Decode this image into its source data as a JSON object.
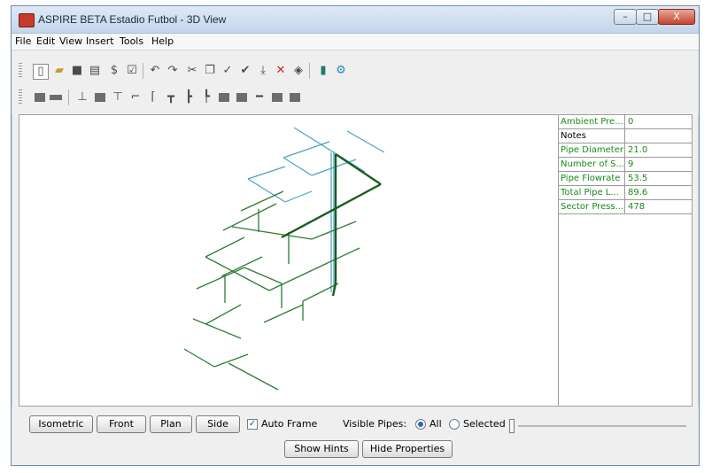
{
  "window": {
    "title": "ASPIRE BETA Estadio Futbol - 3D View",
    "controls": {
      "minimize": "–",
      "maximize": "□",
      "close": "X"
    }
  },
  "menu": [
    "File",
    "Edit",
    "View",
    "Insert",
    "Tools",
    "Help"
  ],
  "toolbar1_icons": [
    "new-document-icon",
    "open-folder-icon",
    "save-icon",
    "print-icon",
    "dollar-icon",
    "checklist-icon",
    "undo-icon",
    "redo-icon",
    "cut-icon",
    "copy-icon",
    "check-icon",
    "check-double-icon",
    "export-icon",
    "delete-icon",
    "pin-icon",
    "book-icon",
    "network-icon"
  ],
  "toolbar2_icons": [
    "pipe-block-icon",
    "pipe-long-icon",
    "valve-icon",
    "fitting-icon",
    "tee-icon",
    "elbow-icon",
    "elbow-alt-icon",
    "cross-icon",
    "reducer-icon",
    "reducer-alt-icon",
    "coupling-icon",
    "cap-icon",
    "straight-pipe-icon",
    "flange-icon",
    "union-icon"
  ],
  "properties": [
    {
      "key": "Ambient Pre...",
      "value": "0"
    },
    {
      "key": "Notes",
      "value": ""
    },
    {
      "key": "Pipe Diameter",
      "value": "21.0"
    },
    {
      "key": "Number of S...",
      "value": "9"
    },
    {
      "key": "Pipe Flowrate",
      "value": "53.5"
    },
    {
      "key": "Total Pipe L...",
      "value": "89.6"
    },
    {
      "key": "Sector Press...",
      "value": "478"
    }
  ],
  "view_buttons": {
    "isometric": "Isometric",
    "front": "Front",
    "plan": "Plan",
    "side": "Side"
  },
  "auto_frame": {
    "label": "Auto Frame",
    "checked": true
  },
  "visible_pipes": {
    "label": "Visible Pipes:",
    "all": "All",
    "selected": "Selected",
    "value": "All"
  },
  "bottom_buttons": {
    "show_hints": "Show Hints",
    "hide_properties": "Hide Properties"
  },
  "colors": {
    "pipe_green": "#2e7d32",
    "pipe_cyan": "#4aa3c7",
    "highlight_green": "#1b5e20"
  }
}
